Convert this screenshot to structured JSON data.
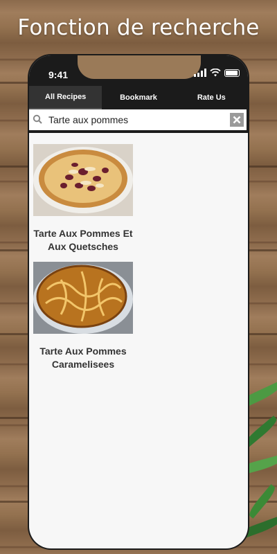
{
  "hero": {
    "title": "Fonction de recherche"
  },
  "status": {
    "time": "9:41"
  },
  "tabs": [
    {
      "label": "All Recipes",
      "active": true
    },
    {
      "label": "Bookmark",
      "active": false
    },
    {
      "label": "Rate Us",
      "active": false
    }
  ],
  "search": {
    "value": "Tarte aux pommes",
    "placeholder": ""
  },
  "results": [
    {
      "title": "Tarte Aux Pommes Et Aux Quetsches"
    },
    {
      "title": "Tarte Aux Pommes Caramelisees"
    }
  ],
  "colors": {
    "bar": "#1b1b1b",
    "active_tab": "#333333",
    "screen_bg": "#f7f7f7",
    "wood": "#8b6a4c"
  },
  "icons": [
    "search-icon",
    "clear-icon",
    "signal-icon",
    "wifi-icon",
    "battery-icon"
  ]
}
